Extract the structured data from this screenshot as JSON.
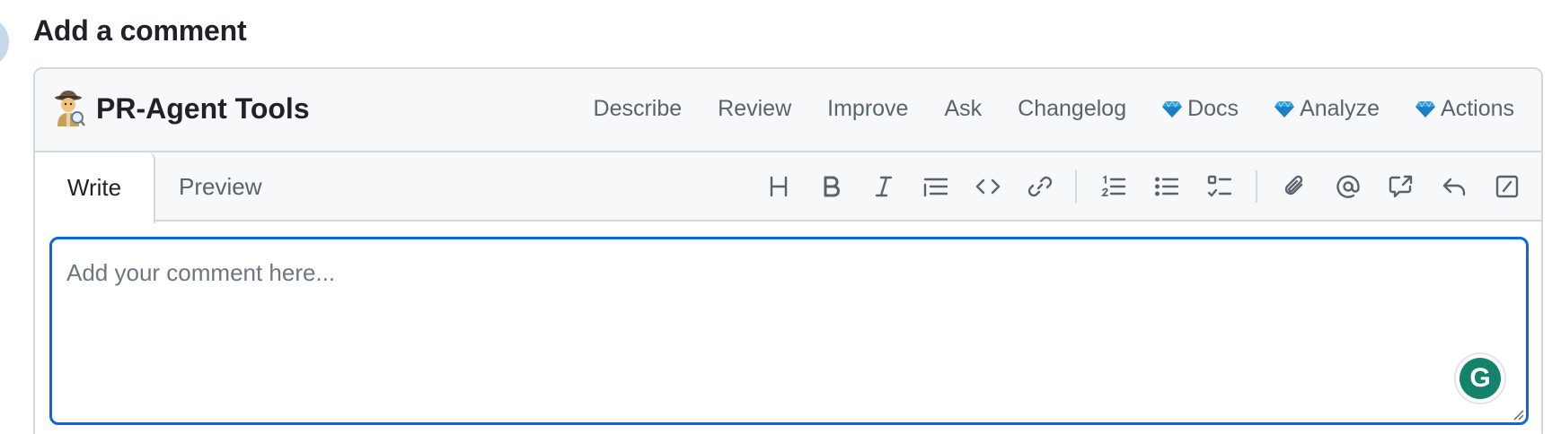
{
  "page": {
    "title": "Add a comment"
  },
  "toolsbar": {
    "title": "PR-Agent Tools",
    "icon": "detective-icon",
    "items": [
      {
        "label": "Describe",
        "premium": false
      },
      {
        "label": "Review",
        "premium": false
      },
      {
        "label": "Improve",
        "premium": false
      },
      {
        "label": "Ask",
        "premium": false
      },
      {
        "label": "Changelog",
        "premium": false
      },
      {
        "label": "Docs",
        "premium": true
      },
      {
        "label": "Analyze",
        "premium": true
      },
      {
        "label": "Actions",
        "premium": true
      }
    ]
  },
  "editor": {
    "tabs": {
      "write": "Write",
      "preview": "Preview",
      "active": "write"
    },
    "toolbar": [
      "heading-icon",
      "bold-icon",
      "italic-icon",
      "quote-icon",
      "code-icon",
      "link-icon",
      "ordered-list-icon",
      "unordered-list-icon",
      "task-list-icon",
      "attach-icon",
      "mention-icon",
      "cross-reference-icon",
      "reply-icon",
      "slash-command-icon"
    ],
    "placeholder": "Add your comment here...",
    "value": "",
    "grammarly_letter": "G"
  },
  "colors": {
    "accent": "#0969da",
    "text": "#1f2328",
    "muted": "#59636e",
    "border": "#d1d9e0",
    "header_bg": "#f6f8fa",
    "grammarly": "#15836c",
    "gem": "#2f9fe3"
  }
}
